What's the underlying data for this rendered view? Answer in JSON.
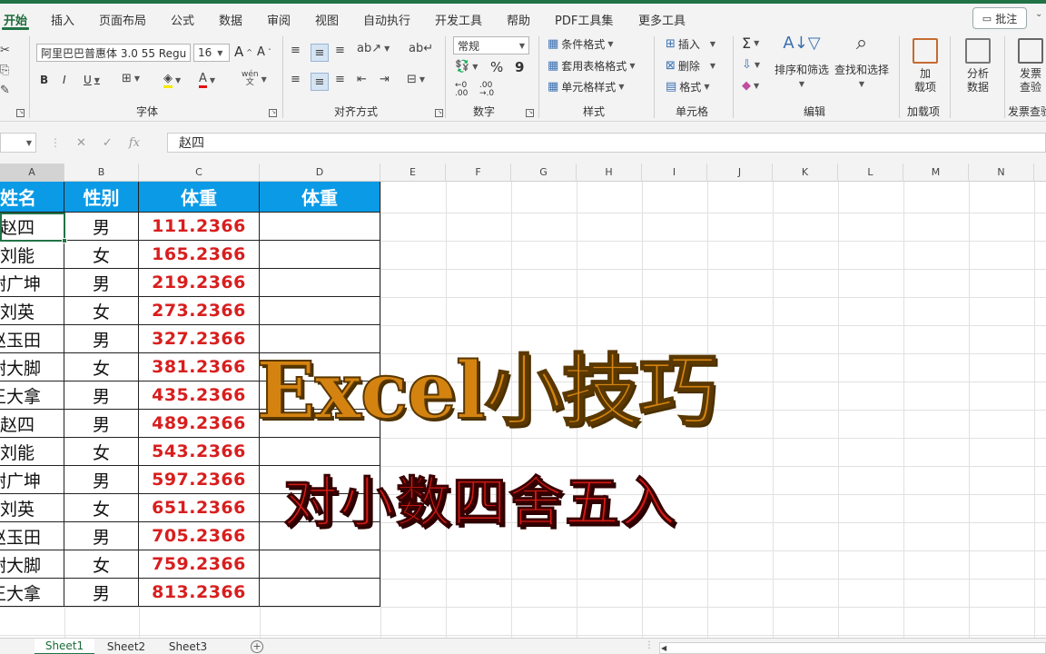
{
  "tabs": [
    "开始",
    "插入",
    "页面布局",
    "公式",
    "数据",
    "审阅",
    "视图",
    "自动执行",
    "开发工具",
    "帮助",
    "PDF工具集",
    "更多工具"
  ],
  "comment_label": "批注",
  "ribbon": {
    "font_name": "阿里巴巴普惠体 3.0 55 Regu",
    "font_size": "16",
    "grow_font": "A",
    "shrink_font": "A",
    "font_group": "字体",
    "align_group": "对齐方式",
    "number_format": "常规",
    "number_group": "数字",
    "cond_format": "条件格式",
    "table_format": "套用表格格式",
    "cell_style": "单元格样式",
    "styles_group": "样式",
    "insert": "插入",
    "delete": "删除",
    "format": "格式",
    "cells_group": "单元格",
    "sort_filter": "排序和筛选",
    "find_select": "查找和选择",
    "editing_group": "编辑",
    "addin_line1": "加",
    "addin_line2": "载项",
    "addin_group": "加载项",
    "analyze_line1": "分析",
    "analyze_line2": "数据",
    "invoice_line1": "发票",
    "invoice_line2": "查验",
    "invoice_group": "发票查验"
  },
  "formula": {
    "fx": "fx",
    "value": "赵四"
  },
  "columns": [
    "A",
    "B",
    "C",
    "D",
    "E",
    "F",
    "G",
    "H",
    "I",
    "J",
    "K",
    "L",
    "M",
    "N"
  ],
  "table": {
    "headers": [
      "姓名",
      "性别",
      "体重",
      "体重"
    ],
    "rows": [
      [
        "赵四",
        "男",
        "111.2366"
      ],
      [
        "刘能",
        "女",
        "165.2366"
      ],
      [
        "谢广坤",
        "男",
        "219.2366"
      ],
      [
        "刘英",
        "女",
        "273.2366"
      ],
      [
        "赵玉田",
        "男",
        "327.2366"
      ],
      [
        "谢大脚",
        "女",
        "381.2366"
      ],
      [
        "王大拿",
        "男",
        "435.2366"
      ],
      [
        "赵四",
        "男",
        "489.2366"
      ],
      [
        "刘能",
        "女",
        "543.2366"
      ],
      [
        "谢广坤",
        "男",
        "597.2366"
      ],
      [
        "刘英",
        "女",
        "651.2366"
      ],
      [
        "赵玉田",
        "男",
        "705.2366"
      ],
      [
        "谢大脚",
        "女",
        "759.2366"
      ],
      [
        "王大拿",
        "男",
        "813.2366"
      ]
    ]
  },
  "overlay": {
    "title": "Excel小技巧",
    "subtitle": "对小数四舍五入"
  },
  "sheets": [
    "Sheet1",
    "Sheet2",
    "Sheet3"
  ],
  "colors": {
    "excel_green": "#217346",
    "header_blue": "#0a9ae6",
    "weight_red": "#d81e1e",
    "title_orange": "#d48311",
    "subtitle_red": "#d31a14"
  }
}
